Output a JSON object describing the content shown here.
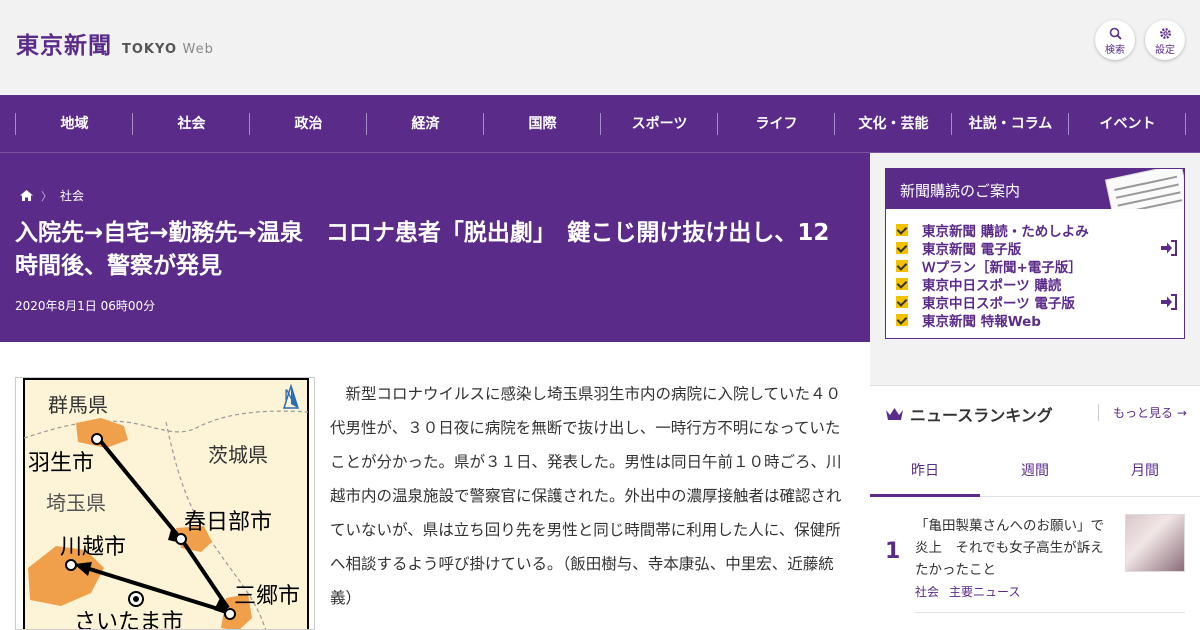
{
  "header": {
    "logo_jp": "東京新聞",
    "logo_en": "TOKYO",
    "logo_en_sub": "Web",
    "search_label": "検索",
    "settings_label": "設定"
  },
  "nav": {
    "items": [
      "地域",
      "社会",
      "政治",
      "経済",
      "国際",
      "スポーツ",
      "ライフ",
      "文化・芸能",
      "社説・コラム",
      "イベント"
    ]
  },
  "breadcrumb": {
    "home_icon": "home-icon",
    "category": "社会"
  },
  "article": {
    "title": "入院先→自宅→勤務先→温泉　コロナ患者「脱出劇」　鍵こじ開け抜け出し、12時間後、警察が発見",
    "date": "2020年8月1日 06時00分",
    "body": "　新型コロナウイルスに感染し埼玉県羽生市内の病院に入院していた４０代男性が、３０日夜に病院を無断で抜け出し、一時行方不明になっていたことが分かった。県が３１日、発表した。男性は同日午前１０時ごろ、川越市内の温泉施設で警察官に保護された。外出中の濃厚接触者は確認されていないが、県は立ち回り先を男性と同じ時間帯に利用した人に、保健所へ相談するよう呼び掛けている。（飯田樹与、寺本康弘、中里宏、近藤統義）"
  },
  "map": {
    "north": "N",
    "labels": {
      "gunma": "群馬県",
      "hanyu": "羽生市",
      "ibaraki": "茨城県",
      "saitama_pref": "埼玉県",
      "kasukabe": "春日部市",
      "kawagoe": "川越市",
      "misato": "三郷市",
      "saitama_city": "さいたま市"
    }
  },
  "subscription": {
    "title": "新聞購読のご案内",
    "items": [
      {
        "label": "東京新聞 購読・ためしよみ",
        "login": false
      },
      {
        "label": "東京新聞 電子版",
        "login": true
      },
      {
        "label": "Ｗプラン［新聞+電子版］",
        "login": false
      },
      {
        "label": "東京中日スポーツ 購読",
        "login": false
      },
      {
        "label": "東京中日スポーツ 電子版",
        "login": true
      },
      {
        "label": "東京新聞 特報Web",
        "login": false
      }
    ]
  },
  "ranking": {
    "title": "ニュースランキング",
    "more": "もっと見る",
    "tabs": [
      "昨日",
      "週間",
      "月間"
    ],
    "active_tab": 0,
    "items": [
      {
        "rank": "1",
        "text": "「亀田製菓さんへのお願い」で炎上　それでも女子高生が訴えたかったこと",
        "tags": [
          "社会",
          "主要ニュース"
        ]
      }
    ]
  },
  "colors": {
    "brand": "#5b2b8a",
    "header_bg": "#f2f2f2",
    "map_land": "#fdf3d7",
    "map_city": "#f0a04b",
    "check": "#f2c200"
  }
}
